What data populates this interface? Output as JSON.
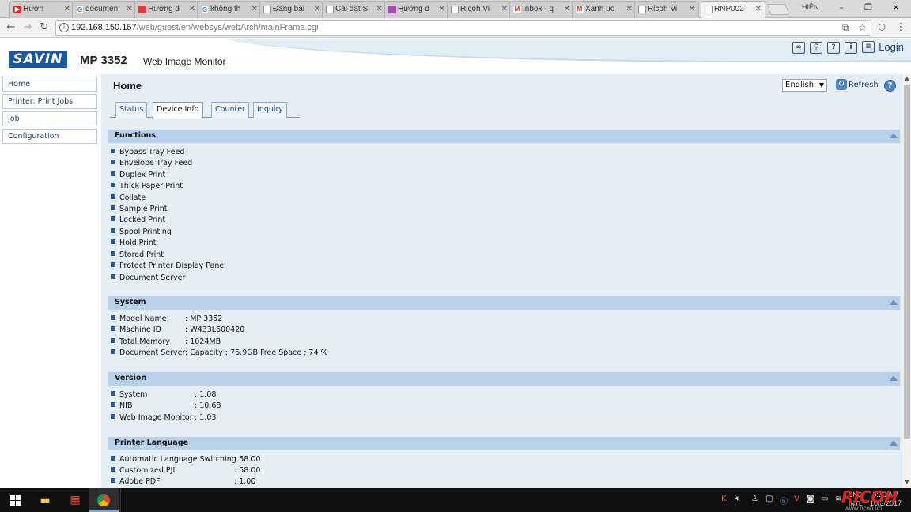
{
  "browser": {
    "tabs": [
      {
        "label": "Hướn",
        "icon": "youtube-icon",
        "color": "#e62117"
      },
      {
        "label": "documen",
        "icon": "google-icon",
        "color": "#4285f4"
      },
      {
        "label": "Hướng d",
        "icon": "bookmark-icon",
        "color": "#e53935"
      },
      {
        "label": "không th",
        "icon": "google-icon",
        "color": "#4285f4"
      },
      {
        "label": "Đăng bài",
        "icon": "page-icon",
        "color": "#888888"
      },
      {
        "label": "Cài đặt S",
        "icon": "page-icon",
        "color": "#888888"
      },
      {
        "label": "Hướng d",
        "icon": "grid-icon",
        "color": "#ab47bc"
      },
      {
        "label": "Ricoh Vi",
        "icon": "page-icon",
        "color": "#888888"
      },
      {
        "label": "Inbox - q",
        "icon": "gmail-icon",
        "color": "#d93025"
      },
      {
        "label": "Xanh uo",
        "icon": "gmail-icon",
        "color": "#d93025"
      },
      {
        "label": "Ricoh Vi",
        "icon": "page-icon",
        "color": "#888888"
      },
      {
        "label": "RNP002",
        "icon": "page-icon",
        "color": "#888888"
      }
    ],
    "active_tab": 11,
    "profile_name": "HIỀN",
    "url_host": "192.168.150.157",
    "url_path": "/web/guest/en/websys/webArch/mainFrame.cgi"
  },
  "header": {
    "logo": "SAVIN",
    "model": "MP 3352",
    "product": "Web Image Monitor",
    "login_label": "Login"
  },
  "leftmenu": {
    "items": [
      "Home",
      "Printer: Print Jobs",
      "Job",
      "Configuration"
    ]
  },
  "main": {
    "title": "Home",
    "language": "English",
    "refresh_label": "Refresh",
    "tabs": [
      "Status",
      "Device Info",
      "Counter",
      "Inquiry"
    ],
    "active_tab": "Device Info"
  },
  "sections": {
    "functions": {
      "title": "Functions",
      "items": [
        "Bypass Tray Feed",
        "Envelope Tray Feed",
        "Duplex Print",
        "Thick Paper Print",
        "Collate",
        "Sample Print",
        "Locked Print",
        "Spool Printing",
        "Hold Print",
        "Stored Print",
        "Protect Printer Display Panel",
        "Document Server"
      ]
    },
    "system": {
      "title": "System",
      "rows": [
        {
          "label": "Model Name",
          "value": ": MP 3352"
        },
        {
          "label": "Machine ID",
          "value": ": W433L600420"
        },
        {
          "label": "Total Memory",
          "value": ": 1024MB"
        },
        {
          "label": "Document Server",
          "value": ": Capacity : 76.9GB Free Space : 74 %"
        }
      ]
    },
    "version": {
      "title": "Version",
      "rows": [
        {
          "label": "System",
          "value": ": 1.08"
        },
        {
          "label": "NIB",
          "value": ": 10.68"
        },
        {
          "label": "Web Image Monitor",
          "value": ": 1.03"
        }
      ]
    },
    "printer_language": {
      "title": "Printer Language",
      "rows": [
        {
          "label": "Automatic Language Switching",
          "value": ": 58.00"
        },
        {
          "label": "Customized PJL",
          "value": ": 58.00"
        },
        {
          "label": "Adobe PDF",
          "value": ": 1.00"
        }
      ]
    }
  },
  "taskbar": {
    "lang_top": "ENG",
    "lang_bottom": "INTL",
    "time": "9:30 AM",
    "date": "10/3/2017"
  },
  "watermark": {
    "brand": "RICOH",
    "site": "www.ricoh.vn"
  },
  "colors": {
    "section_header": "#b8d1e8",
    "main_bg": "#e5edf5",
    "brand_blue": "#1d56a3"
  }
}
